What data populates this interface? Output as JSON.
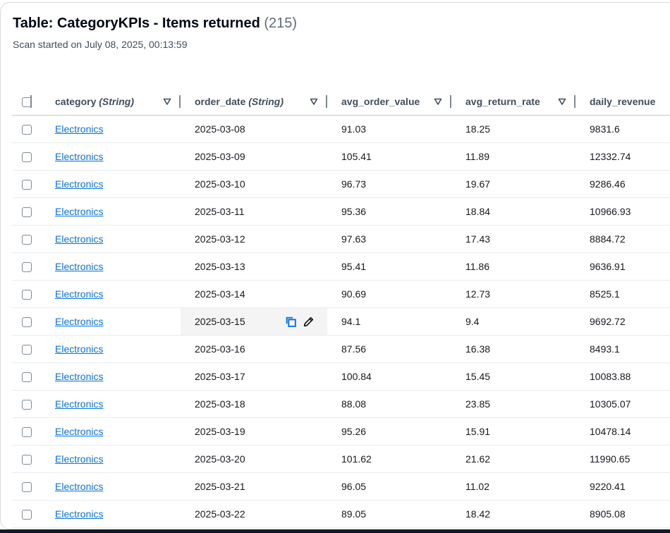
{
  "header": {
    "title": "Table: CategoryKPIs - Items returned",
    "count": "(215)",
    "scan_text": "Scan started on July 08, 2025, 00:13:59"
  },
  "columns": [
    {
      "name": "category",
      "type": "(String)"
    },
    {
      "name": "order_date",
      "type": "(String)"
    },
    {
      "name": "avg_order_value",
      "type": ""
    },
    {
      "name": "avg_return_rate",
      "type": ""
    },
    {
      "name": "daily_revenue",
      "type": ""
    }
  ],
  "rows": [
    {
      "category": "Electronics",
      "order_date": "2025-03-08",
      "avg_order_value": "91.03",
      "avg_return_rate": "18.25",
      "daily_revenue": "9831.6"
    },
    {
      "category": "Electronics",
      "order_date": "2025-03-09",
      "avg_order_value": "105.41",
      "avg_return_rate": "11.89",
      "daily_revenue": "12332.74"
    },
    {
      "category": "Electronics",
      "order_date": "2025-03-10",
      "avg_order_value": "96.73",
      "avg_return_rate": "19.67",
      "daily_revenue": "9286.46"
    },
    {
      "category": "Electronics",
      "order_date": "2025-03-11",
      "avg_order_value": "95.36",
      "avg_return_rate": "18.84",
      "daily_revenue": "10966.93"
    },
    {
      "category": "Electronics",
      "order_date": "2025-03-12",
      "avg_order_value": "97.63",
      "avg_return_rate": "17.43",
      "daily_revenue": "8884.72"
    },
    {
      "category": "Electronics",
      "order_date": "2025-03-13",
      "avg_order_value": "95.41",
      "avg_return_rate": "11.86",
      "daily_revenue": "9636.91"
    },
    {
      "category": "Electronics",
      "order_date": "2025-03-14",
      "avg_order_value": "90.69",
      "avg_return_rate": "12.73",
      "daily_revenue": "8525.1"
    },
    {
      "category": "Electronics",
      "order_date": "2025-03-15",
      "avg_order_value": "94.1",
      "avg_return_rate": "9.4",
      "daily_revenue": "9692.72",
      "hovered": true
    },
    {
      "category": "Electronics",
      "order_date": "2025-03-16",
      "avg_order_value": "87.56",
      "avg_return_rate": "16.38",
      "daily_revenue": "8493.1"
    },
    {
      "category": "Electronics",
      "order_date": "2025-03-17",
      "avg_order_value": "100.84",
      "avg_return_rate": "15.45",
      "daily_revenue": "10083.88"
    },
    {
      "category": "Electronics",
      "order_date": "2025-03-18",
      "avg_order_value": "88.08",
      "avg_return_rate": "23.85",
      "daily_revenue": "10305.07"
    },
    {
      "category": "Electronics",
      "order_date": "2025-03-19",
      "avg_order_value": "95.26",
      "avg_return_rate": "15.91",
      "daily_revenue": "10478.14"
    },
    {
      "category": "Electronics",
      "order_date": "2025-03-20",
      "avg_order_value": "101.62",
      "avg_return_rate": "21.62",
      "daily_revenue": "11990.65"
    },
    {
      "category": "Electronics",
      "order_date": "2025-03-21",
      "avg_order_value": "96.05",
      "avg_return_rate": "11.02",
      "daily_revenue": "9220.41"
    },
    {
      "category": "Electronics",
      "order_date": "2025-03-22",
      "avg_order_value": "89.05",
      "avg_return_rate": "18.42",
      "daily_revenue": "8905.08"
    }
  ],
  "icons": {
    "sort": "sort-caret-down-icon",
    "copy": "copy-icon",
    "edit": "pencil-edit-icon"
  },
  "colors": {
    "link": "#0972d3",
    "hover_row": "#f4f4f4",
    "action_icon": "#0972d3"
  }
}
